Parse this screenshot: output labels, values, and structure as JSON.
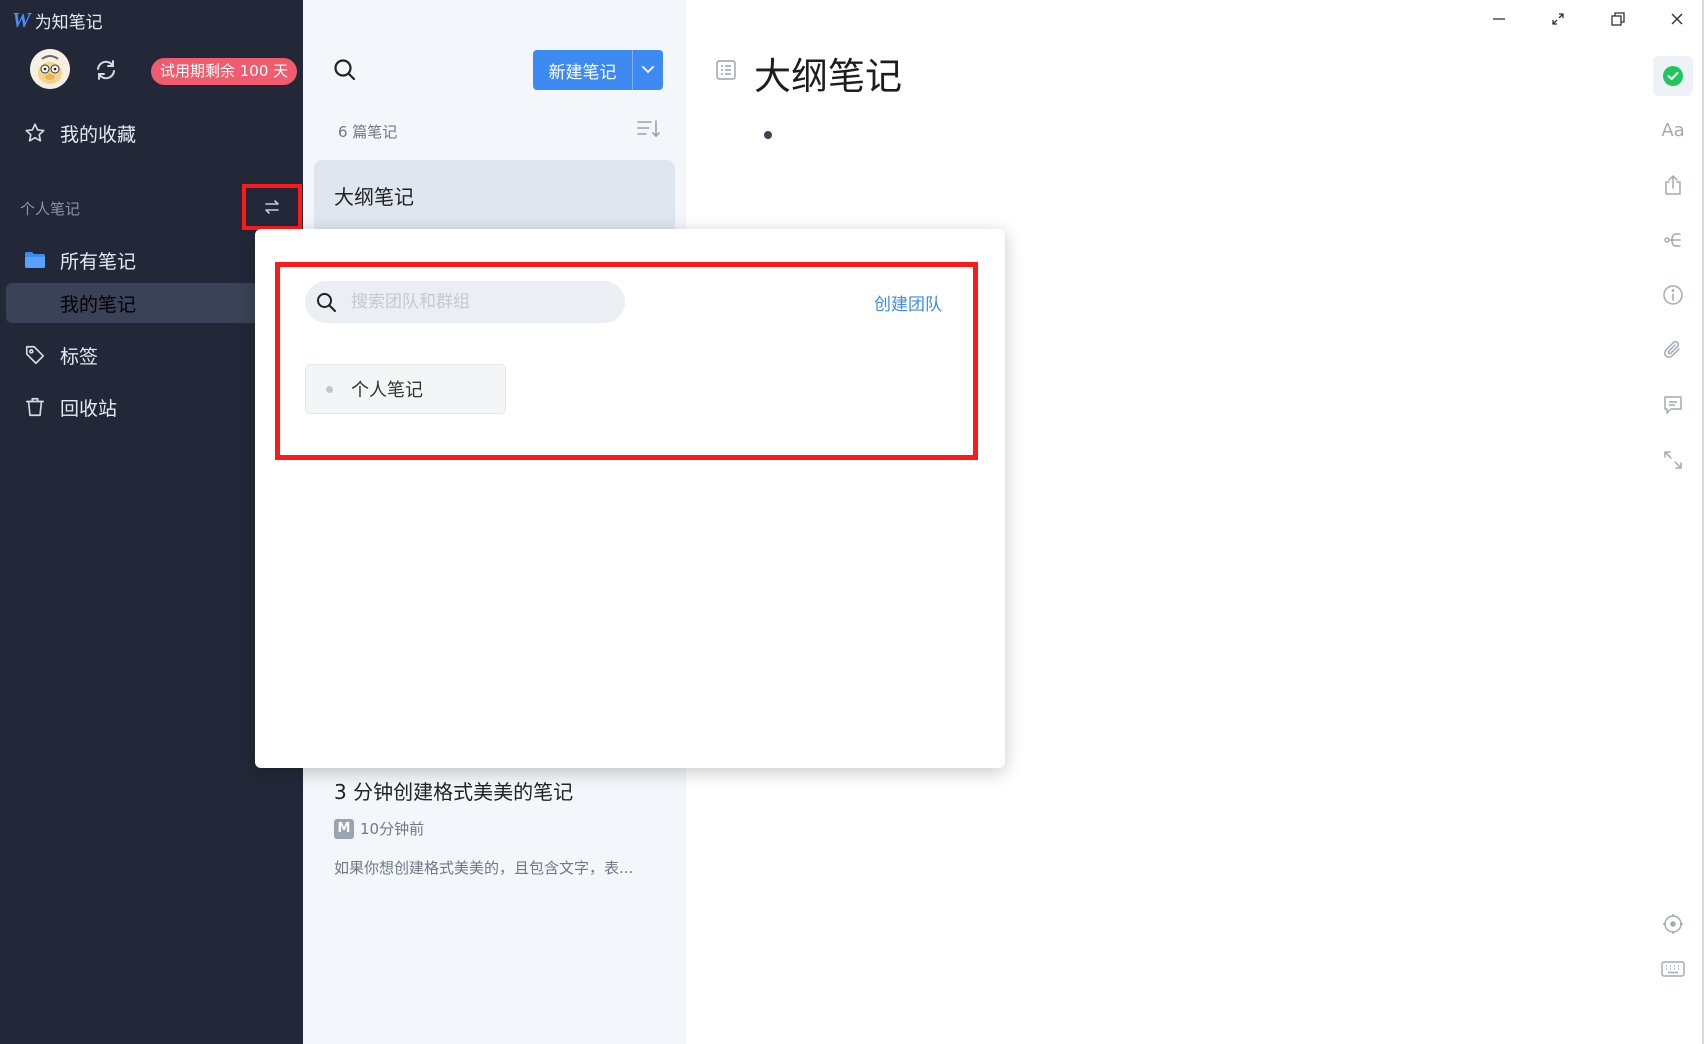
{
  "app": {
    "logo": "W",
    "title": "为知笔记"
  },
  "window_controls": [
    "minimize-icon",
    "fullscreen-icon",
    "restore-icon",
    "close-icon"
  ],
  "sidebar": {
    "trial_badge": "试用期剩余 100 天",
    "favorites": "我的收藏",
    "section_label": "个人笔记",
    "all_notes": "所有笔记",
    "my_notes": "我的笔记",
    "tags": "标签",
    "trash": "回收站"
  },
  "note_list": {
    "new_note": "新建笔记",
    "count": "6 篇笔记",
    "notes": [
      {
        "title": "大纲笔记"
      },
      {
        "title": "3 分钟创建格式美美的笔记",
        "badge": "M",
        "time": "10分钟前",
        "preview": "如果你想创建格式美美的，且包含文字，表..."
      }
    ]
  },
  "editor": {
    "title": "大纲笔记"
  },
  "right_toolbar": {
    "font_label": "Aa"
  },
  "team_popup": {
    "search_placeholder": "搜索团队和群组",
    "create_team": "创建团队",
    "teams": [
      "个人笔记"
    ]
  },
  "colors": {
    "sidebar_bg": "#232838",
    "accent": "#3d8bf2",
    "trial": "#f05b6e",
    "highlight": "#ff1a1a",
    "ok": "#22c55e"
  }
}
